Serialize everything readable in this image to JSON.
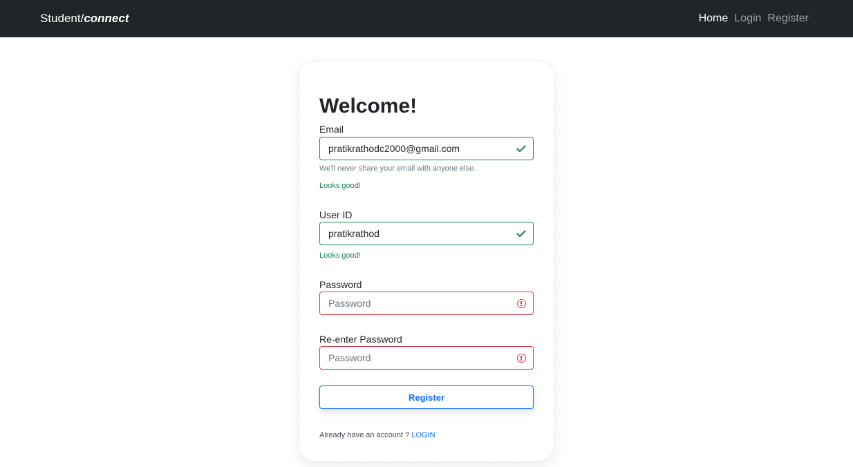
{
  "navbar": {
    "brand_prefix": "Student/",
    "brand_accent": "connect",
    "links": [
      {
        "label": "Home"
      },
      {
        "label": "Login"
      },
      {
        "label": "Register"
      }
    ]
  },
  "form": {
    "title": "Welcome!",
    "email": {
      "label": "Email",
      "value": "pratikrathodc2000@gmail.com",
      "help": "We'll never share your email with anyone else.",
      "feedback": "Looks good!"
    },
    "user_id": {
      "label": "User ID",
      "value": "pratikrathod",
      "feedback": "Looks good!"
    },
    "password": {
      "label": "Password",
      "placeholder": "Password"
    },
    "confirm_password": {
      "label": "Re-enter Password",
      "placeholder": "Password"
    },
    "submit_label": "Register",
    "account_prompt": "Already have an account ?",
    "login_link": "LOGIN"
  },
  "colors": {
    "navbar_bg": "#212529",
    "valid": "#198754",
    "invalid": "#dc3545",
    "primary": "#0d6efd"
  },
  "icons": [
    "check-icon",
    "alert-circle-icon"
  ]
}
